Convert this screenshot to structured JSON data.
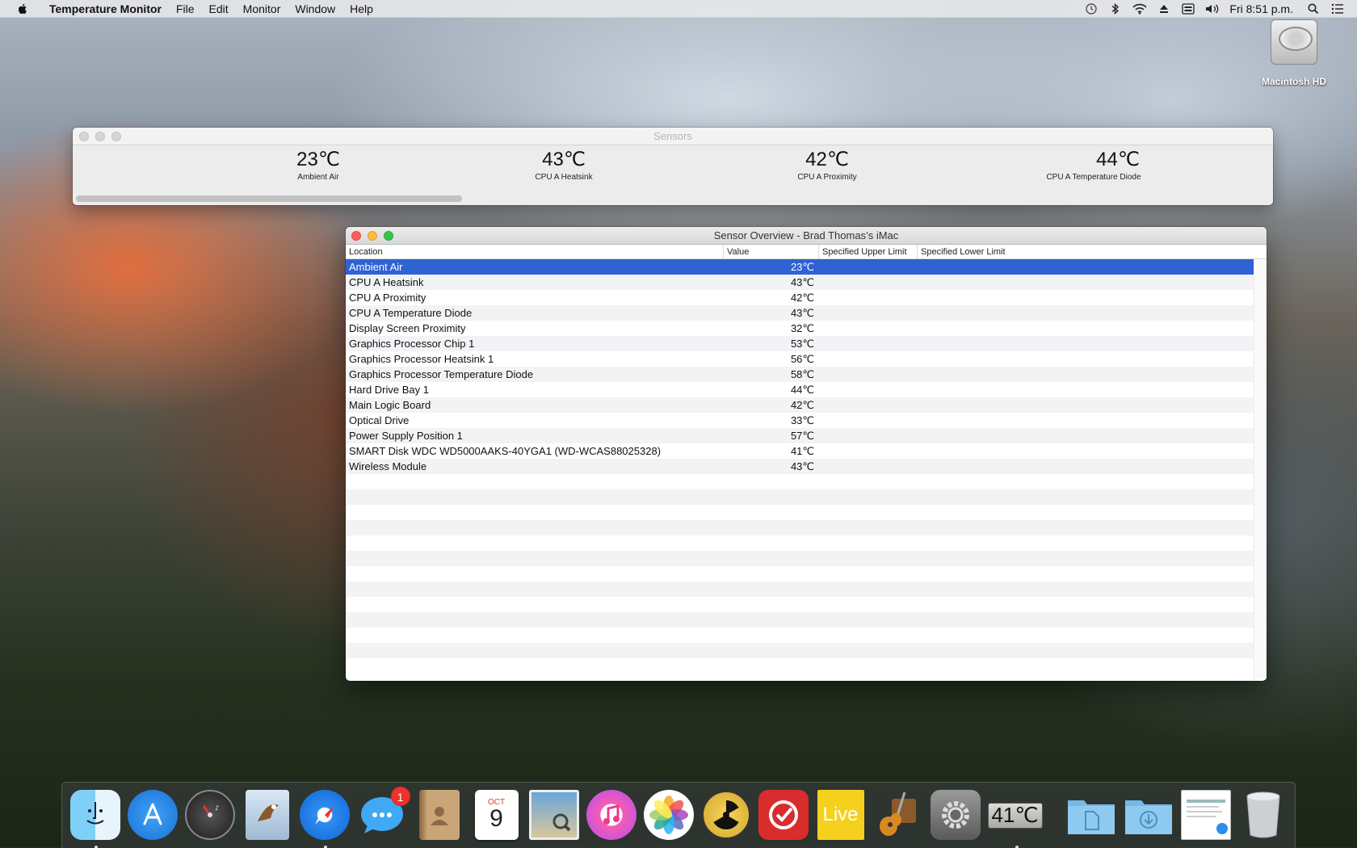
{
  "menubar": {
    "app_name": "Temperature Monitor",
    "menus": [
      "File",
      "Edit",
      "Monitor",
      "Window",
      "Help"
    ],
    "clock": "Fri 8:51 p.m."
  },
  "desktop": {
    "macintosh_hd_label": "Macintosh HD"
  },
  "sensors_window": {
    "title": "Sensors",
    "readouts": [
      {
        "value": "23℃",
        "label": "Ambient Air"
      },
      {
        "value": "43℃",
        "label": "CPU A Heatsink"
      },
      {
        "value": "42℃",
        "label": "CPU A Proximity"
      },
      {
        "value": "44℃",
        "label": "CPU A Temperature Diode"
      }
    ]
  },
  "overview_window": {
    "title": "Sensor Overview - Brad Thomas’s iMac",
    "columns": {
      "location": "Location",
      "value": "Value",
      "upper": "Specified Upper Limit",
      "lower": "Specified Lower Limit"
    },
    "rows": [
      {
        "location": "Ambient Air",
        "value": "23℃"
      },
      {
        "location": "CPU A Heatsink",
        "value": "43℃"
      },
      {
        "location": "CPU A Proximity",
        "value": "42℃"
      },
      {
        "location": "CPU A Temperature Diode",
        "value": "43℃"
      },
      {
        "location": "Display Screen Proximity",
        "value": "32℃"
      },
      {
        "location": "Graphics Processor Chip 1",
        "value": "53℃"
      },
      {
        "location": "Graphics Processor Heatsink 1",
        "value": "56℃"
      },
      {
        "location": "Graphics Processor Temperature Diode",
        "value": "58℃"
      },
      {
        "location": "Hard Drive Bay 1",
        "value": "44℃"
      },
      {
        "location": "Main Logic Board",
        "value": "42℃"
      },
      {
        "location": "Optical Drive",
        "value": "33℃"
      },
      {
        "location": "Power Supply Position 1",
        "value": "57℃"
      },
      {
        "location": "SMART Disk WDC WD5000AAKS-40YGA1 (WD-WCAS88025328)",
        "value": "41℃"
      },
      {
        "location": "Wireless Module",
        "value": "43℃"
      }
    ],
    "selected_row": "Ambient Air"
  },
  "dock": {
    "messages_badge": "1",
    "calendar_month": "OCT",
    "calendar_day": "9",
    "live_label": "Live",
    "temp_display": "41℃"
  },
  "colors": {
    "selection": "#2f62d3",
    "close": "#fc605c",
    "minimize": "#fdbc40",
    "zoom": "#34c84a"
  }
}
